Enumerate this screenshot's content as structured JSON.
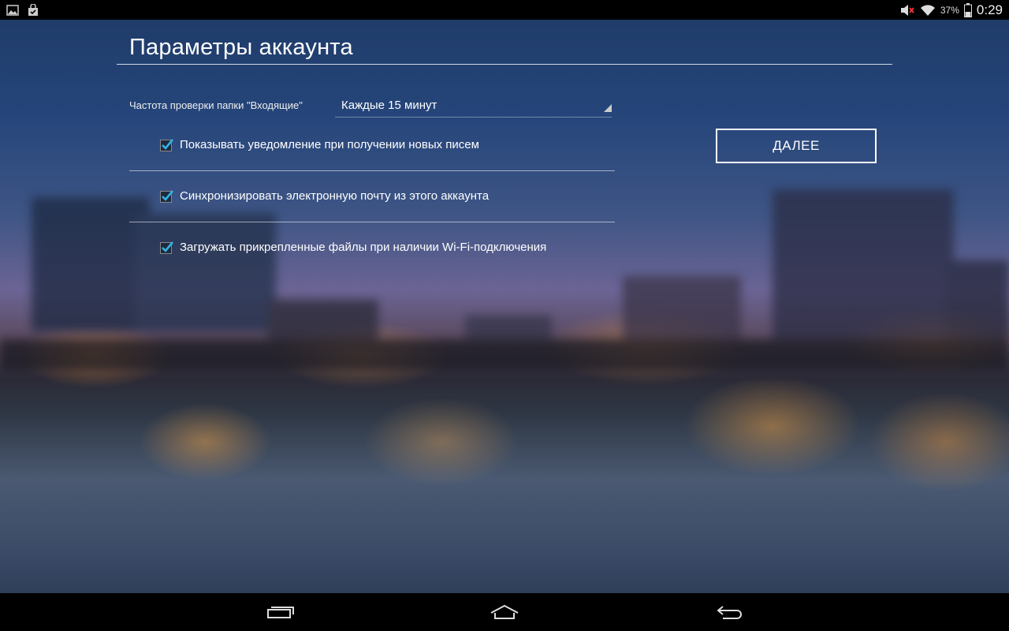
{
  "status_bar": {
    "left_icons": [
      "image-icon",
      "shopping-bag-icon"
    ],
    "battery_percent": "37%",
    "time": "0:29"
  },
  "page": {
    "title": "Параметры аккаунта"
  },
  "sync_frequency": {
    "label": "Частота проверки папки \"Входящие\"",
    "selected": "Каждые 15 минут"
  },
  "options": [
    {
      "label": "Показывать уведомление при получении новых писем",
      "checked": true
    },
    {
      "label": "Синхронизировать электронную почту из этого аккаунта",
      "checked": true
    },
    {
      "label": "Загружать прикрепленные файлы при наличии Wi-Fi-подключения",
      "checked": true
    }
  ],
  "next_button": {
    "label": "ДАЛЕЕ"
  },
  "nav_bar": {
    "buttons": [
      "recent-apps-icon",
      "home-icon",
      "back-icon"
    ]
  },
  "colors": {
    "accent": "#33b5e5",
    "bars": "#000000"
  }
}
